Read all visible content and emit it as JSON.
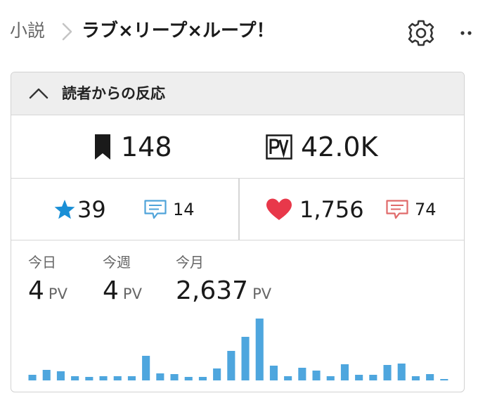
{
  "breadcrumb": {
    "parent": "小説",
    "title": "ラブ×リープ×ループ！"
  },
  "header_icons": [
    "gear-icon",
    "more-icon"
  ],
  "card": {
    "title": "読者からの反応",
    "bookmarks": "148",
    "pv_total": "42.0K",
    "stars": "39",
    "star_comments": "14",
    "likes": "1,756",
    "like_comments": "74",
    "periods": [
      {
        "label": "今日",
        "value": "4",
        "unit": "PV"
      },
      {
        "label": "今週",
        "value": "4",
        "unit": "PV"
      },
      {
        "label": "今月",
        "value": "2,637",
        "unit": "PV"
      }
    ]
  },
  "colors": {
    "star": "#1a8fd6",
    "heart": "#e8384a",
    "comment_blue": "#4fa3d9",
    "comment_red": "#e06a6a",
    "bar": "#4ea6de"
  },
  "chart_data": {
    "type": "bar",
    "title": "",
    "xlabel": "",
    "ylabel": "",
    "values": [
      8,
      15,
      13,
      6,
      5,
      6,
      6,
      6,
      35,
      10,
      9,
      5,
      5,
      17,
      42,
      62,
      88,
      21,
      6,
      18,
      14,
      6,
      23,
      8,
      8,
      22,
      24,
      6,
      9,
      2
    ],
    "ylim": [
      0,
      88
    ]
  }
}
